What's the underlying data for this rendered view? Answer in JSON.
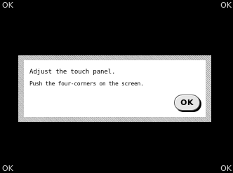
{
  "corners": {
    "top_left": "OK",
    "top_right": "OK",
    "bottom_left": "OK",
    "bottom_right": "OK"
  },
  "dialog": {
    "line1": "Adjust the touch panel.",
    "line2": "Push the four-corners on the screen.",
    "ok_label": "OK"
  },
  "colors": {
    "background": "#000000",
    "dialog_background": "#ffffff",
    "frame": "#bdbdbd"
  }
}
